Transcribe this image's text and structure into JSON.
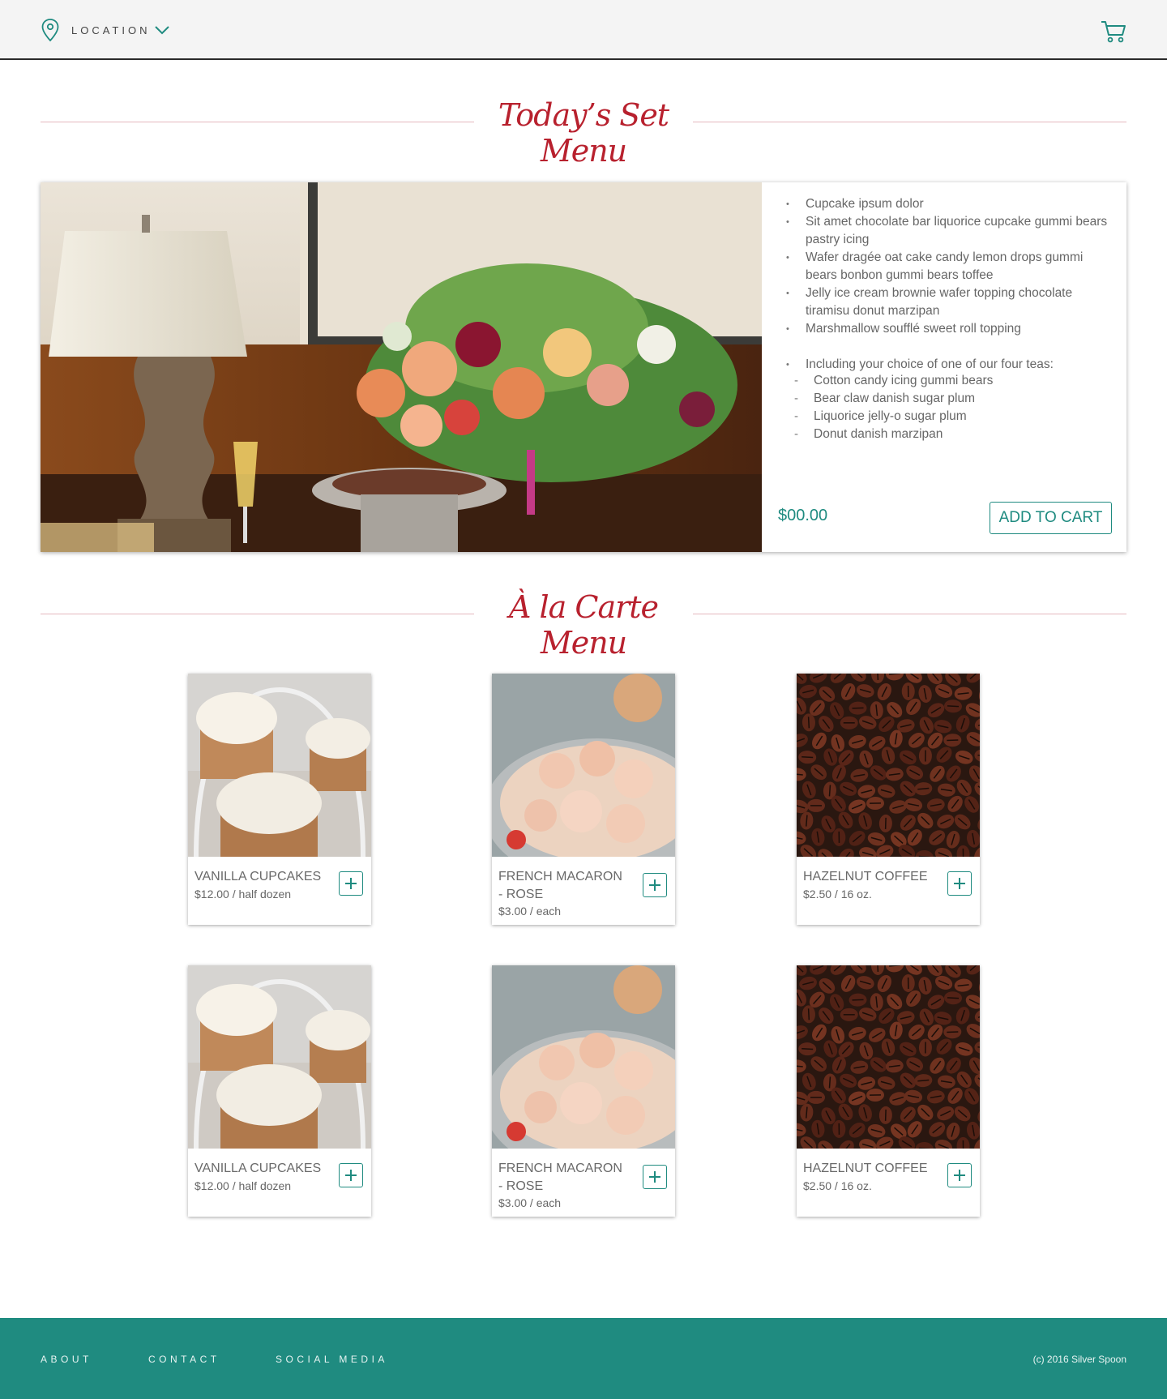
{
  "header": {
    "location_label": "LOCATION",
    "icons": [
      "map-pin-icon",
      "chevron-down-icon",
      "shopping-cart-icon"
    ]
  },
  "set_menu": {
    "title": "Today’s Set Menu",
    "items": [
      "Cupcake ipsum dolor",
      "Sit amet chocolate bar liquorice cupcake gummi bears pastry icing",
      "Wafer dragée oat cake candy lemon drops gummi bears bonbon gummi bears toffee",
      "Jelly ice cream brownie wafer topping chocolate tiramisu donut marzipan",
      "Marshmallow soufflé sweet roll topping"
    ],
    "tea_intro": "Including your choice of one of our four teas:",
    "teas": [
      "Cotton candy icing gummi bears",
      "Bear claw danish sugar plum",
      "Liquorice jelly-o sugar plum",
      "Donut danish marzipan"
    ],
    "price": "$00.00",
    "add_to_cart": "ADD TO CART"
  },
  "a_la_carte": {
    "title": "À la Carte Menu",
    "products": [
      {
        "name": "VANILLA CUPCAKES",
        "price": "$12.00 / half dozen",
        "image": "cupcakes"
      },
      {
        "name": "FRENCH MACARON - ROSE",
        "price": "$3.00 / each",
        "image": "macarons"
      },
      {
        "name": "HAZELNUT COFFEE",
        "price": "$2.50 / 16 oz.",
        "image": "coffee-beans"
      },
      {
        "name": "VANILLA CUPCAKES",
        "price": "$12.00 / half dozen",
        "image": "cupcakes"
      },
      {
        "name": "FRENCH MACARON - ROSE",
        "price": "$3.00 / each",
        "image": "macarons"
      },
      {
        "name": "HAZELNUT COFFEE",
        "price": "$2.50 / 16 oz.",
        "image": "coffee-beans"
      }
    ]
  },
  "footer": {
    "about": "ABOUT",
    "contact": "CONTACT",
    "social": "SOCIAL MEDIA",
    "copyright": "(c) 2016 Silver Spoon"
  },
  "colors": {
    "accent": "#1f8b80",
    "heading_red": "#b8212e",
    "divider": "#e4b8be"
  }
}
